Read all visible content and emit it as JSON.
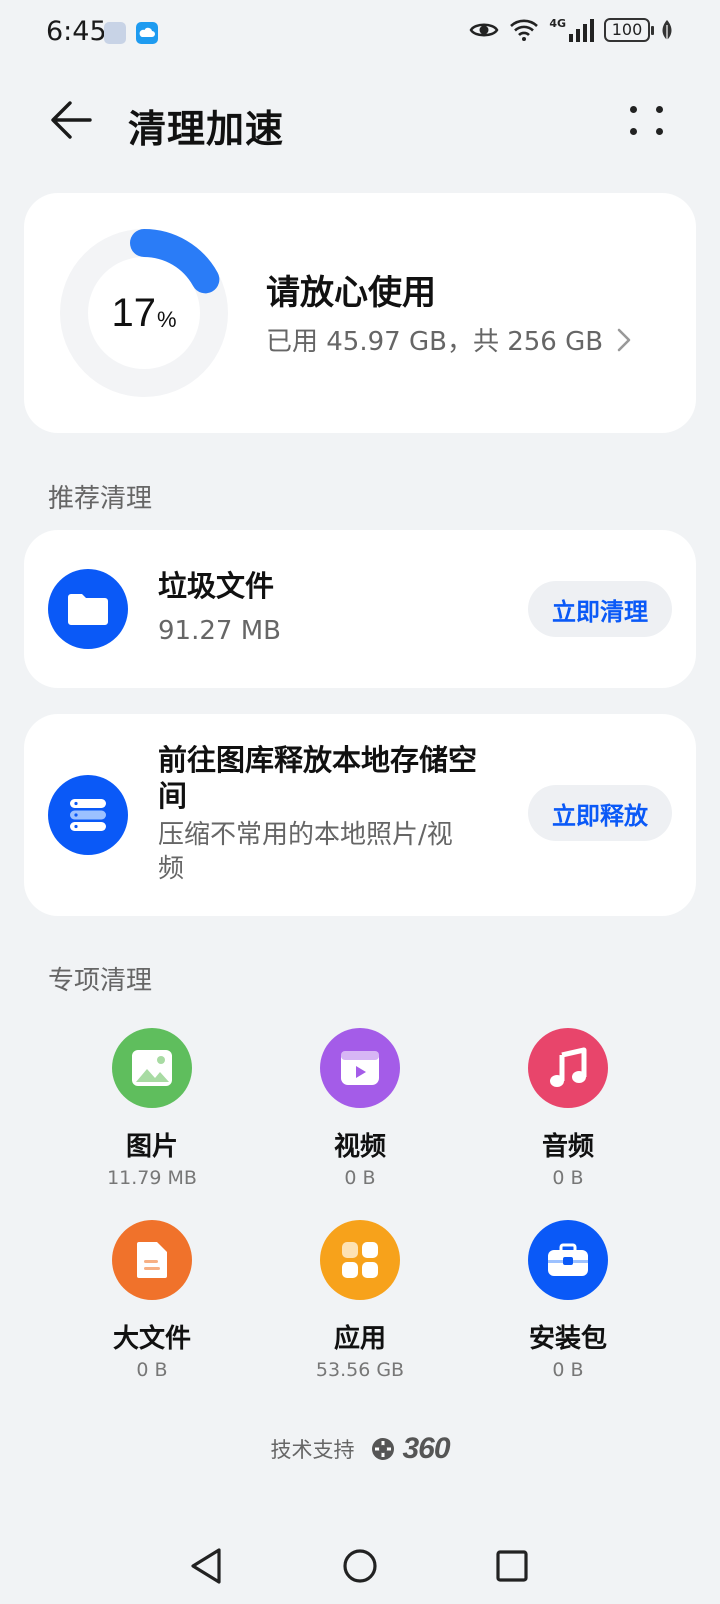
{
  "status_bar": {
    "time": "6:45",
    "network": "4G",
    "battery": "100",
    "icons": [
      "eye-icon",
      "wifi-icon",
      "signal-icon",
      "battery-icon",
      "leaf-icon"
    ]
  },
  "header": {
    "title": "清理加速",
    "back_icon": "arrow-left-icon",
    "more_icon": "more-dots-icon"
  },
  "storage": {
    "used_percent": 17,
    "percent_value": "17",
    "percent_sign": "%",
    "status": "请放心使用",
    "detail": "已用 45.97 GB，共 256 GB",
    "ring_color": "#2a7cf7",
    "track_color": "#f3f4f6"
  },
  "recommended": {
    "heading": "推荐清理",
    "items": [
      {
        "title": "垃圾文件",
        "subtitle": "91.27 MB",
        "button": "立即清理",
        "icon": "folder-icon"
      },
      {
        "title_line1": "前往图库释放本地存储空",
        "title_line2": "间",
        "subtitle_line1": "压缩不常用的本地照片/视",
        "subtitle_line2": "频",
        "button": "立即释放",
        "icon": "storage-stack-icon"
      }
    ]
  },
  "special": {
    "heading": "专项清理",
    "items": [
      {
        "label": "图片",
        "size": "11.79 MB",
        "icon": "image-icon",
        "color": "#5fbe5d"
      },
      {
        "label": "视频",
        "size": "0 B",
        "icon": "video-icon",
        "color": "#a45ce8"
      },
      {
        "label": "音频",
        "size": "0 B",
        "icon": "music-icon",
        "color": "#e8456b"
      },
      {
        "label": "大文件",
        "size": "0 B",
        "icon": "document-icon",
        "color": "#f0722b"
      },
      {
        "label": "应用",
        "size": "53.56 GB",
        "icon": "apps-icon",
        "color": "#f7a21b"
      },
      {
        "label": "安装包",
        "size": "0 B",
        "icon": "toolbox-icon",
        "color": "#0a59f7"
      }
    ]
  },
  "footer": {
    "support_text": "技术支持",
    "brand": "360"
  },
  "nav": {
    "icons": [
      "back-triangle-icon",
      "home-circle-icon",
      "recents-square-icon"
    ]
  }
}
